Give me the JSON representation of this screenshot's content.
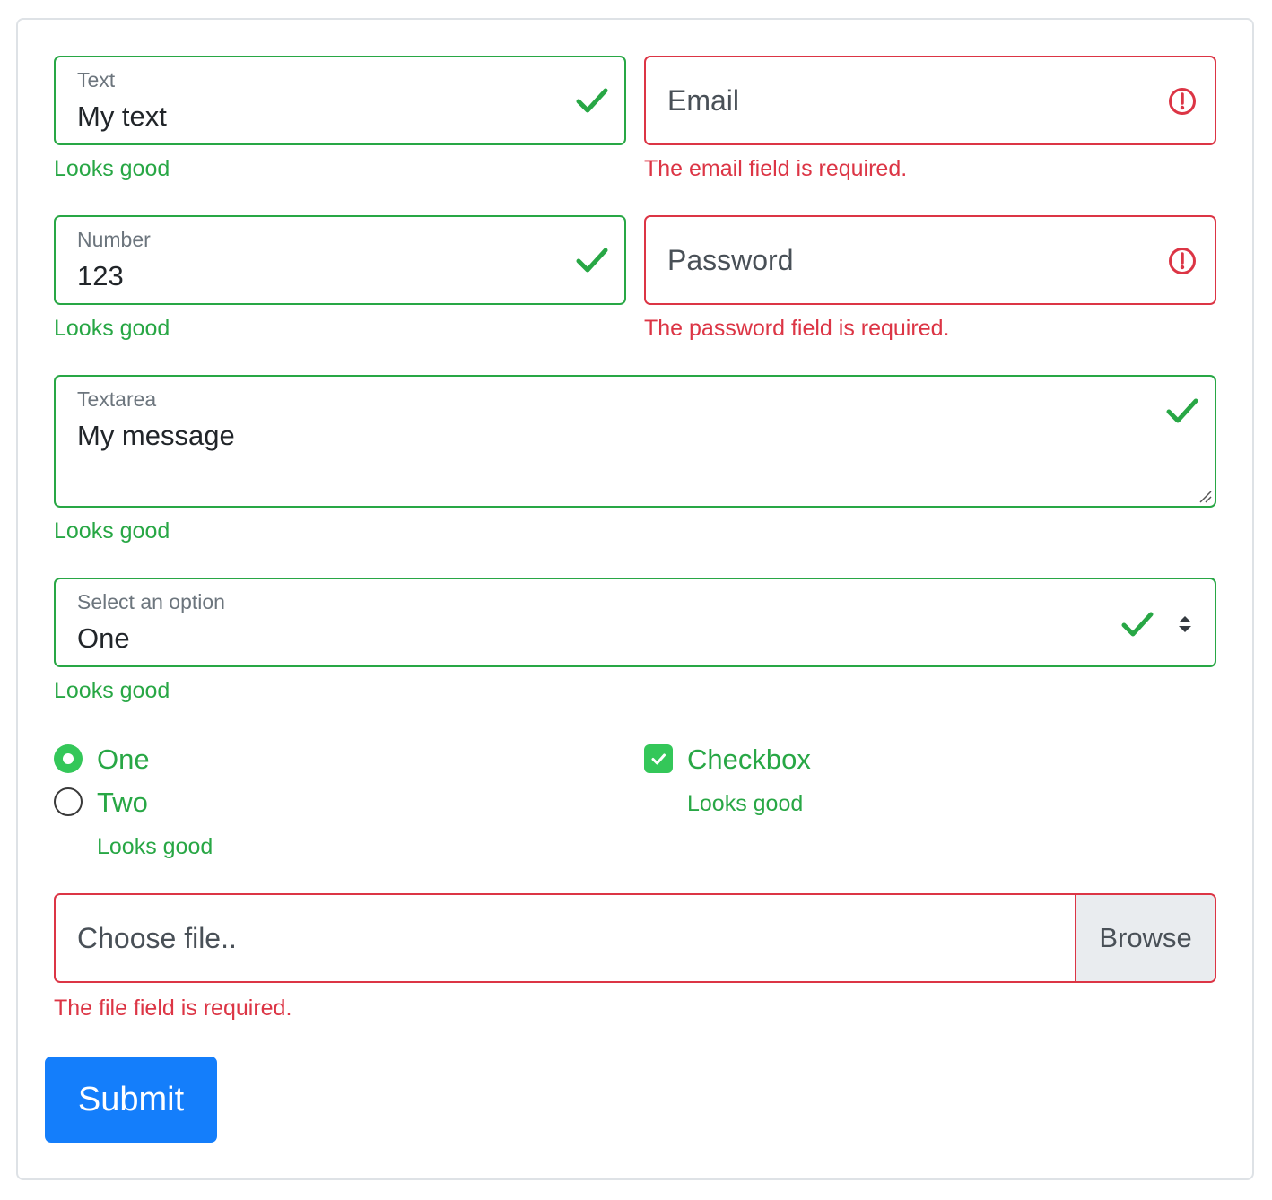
{
  "text_field": {
    "label": "Text",
    "value": "My text",
    "feedback": "Looks good"
  },
  "email_field": {
    "placeholder": "Email",
    "feedback": "The email field is required."
  },
  "number_field": {
    "label": "Number",
    "value": "123",
    "feedback": "Looks good"
  },
  "password_field": {
    "placeholder": "Password",
    "feedback": "The password field is required."
  },
  "textarea_field": {
    "label": "Textarea",
    "value": "My message",
    "feedback": "Looks good"
  },
  "select_field": {
    "label": "Select an option",
    "value": "One",
    "feedback": "Looks good"
  },
  "radio_group": {
    "options": [
      {
        "label": "One",
        "checked": true
      },
      {
        "label": "Two",
        "checked": false
      }
    ],
    "feedback": "Looks good"
  },
  "checkbox": {
    "label": "Checkbox",
    "checked": true,
    "feedback": "Looks good"
  },
  "file_field": {
    "placeholder": "Choose file..",
    "browse_label": "Browse",
    "feedback": "The file field is required."
  },
  "submit": {
    "label": "Submit"
  },
  "colors": {
    "valid": "#28a745",
    "invalid": "#dc3545",
    "primary": "#147efb",
    "check_fill": "#34c759"
  },
  "icons": {
    "valid": "check-icon",
    "invalid": "exclamation-circle-icon",
    "select": "updown-caret-icon"
  }
}
